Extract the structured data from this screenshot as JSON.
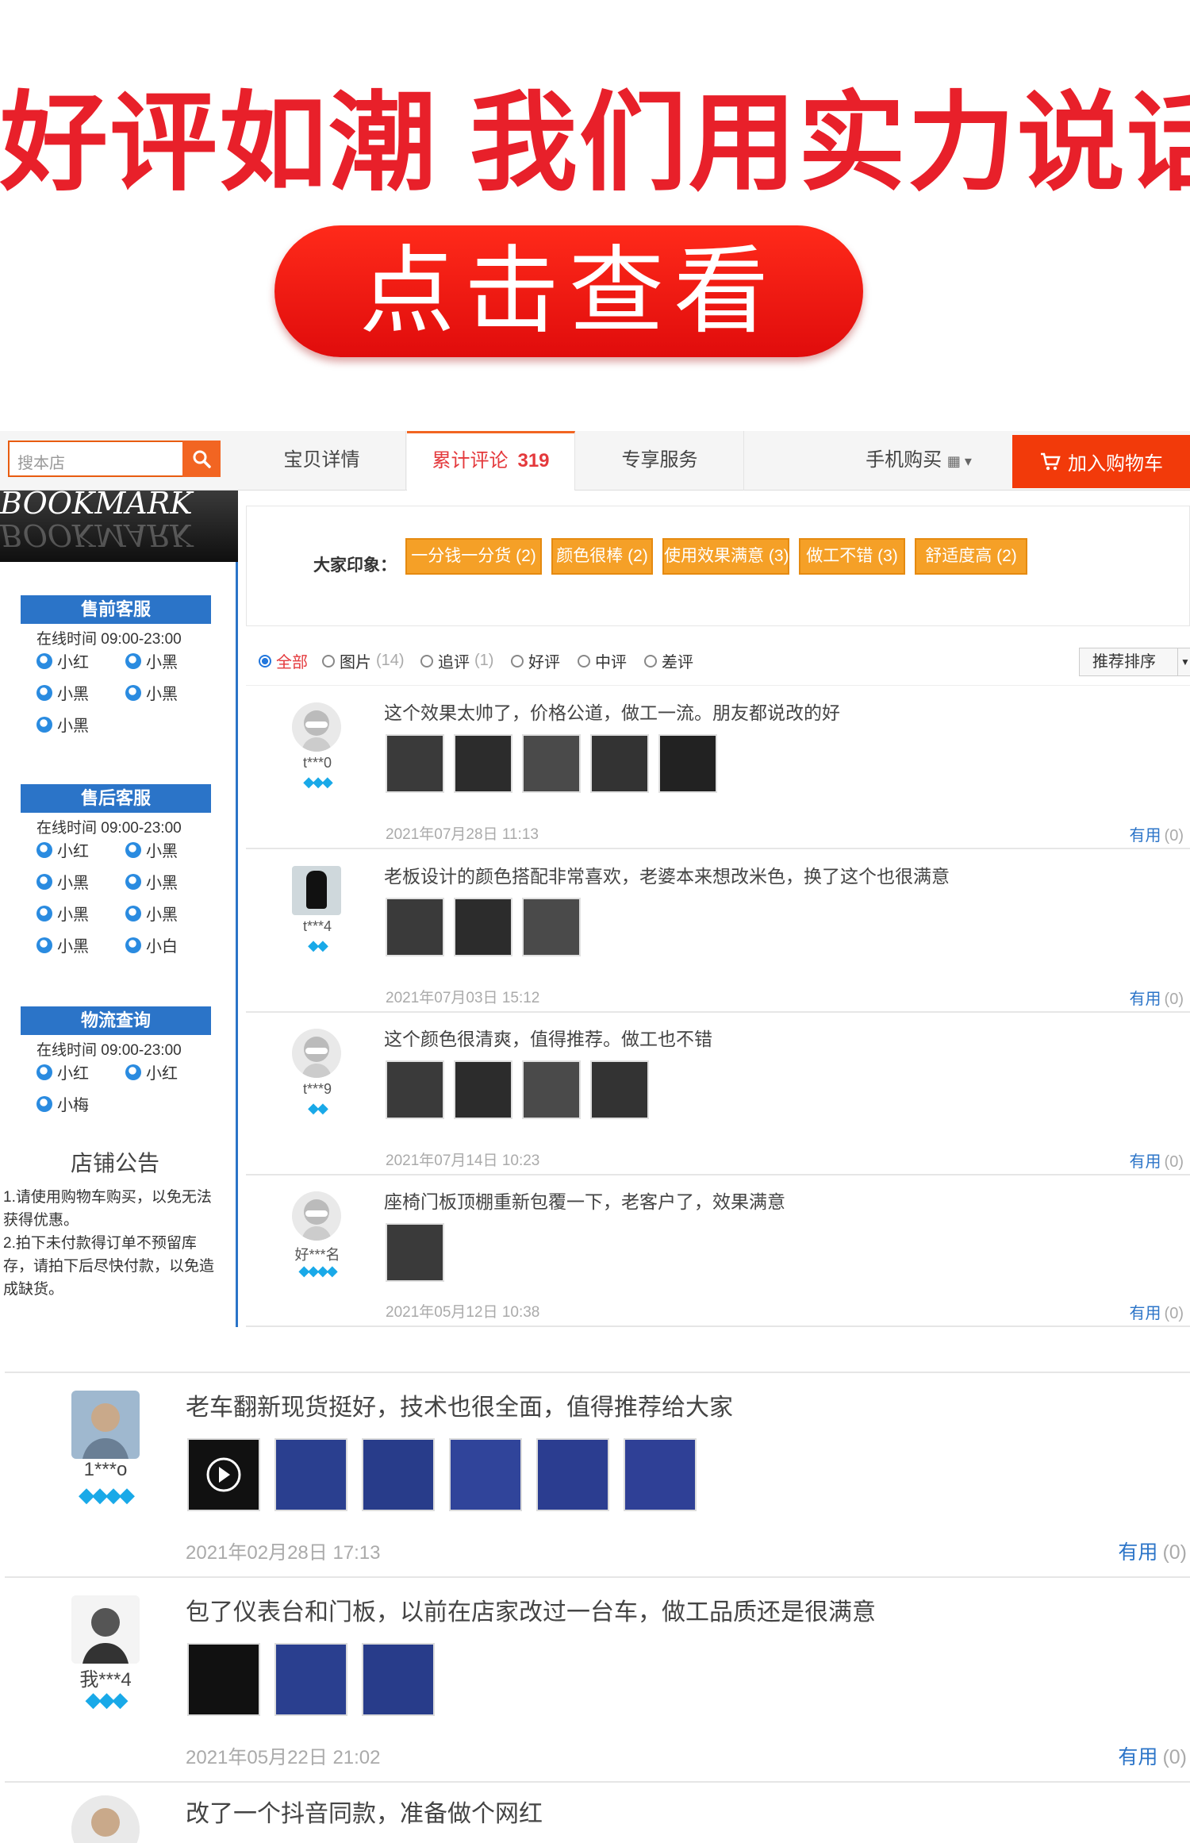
{
  "banner": {
    "slogan": "好评如潮  我们用实力说话",
    "cta_label": "点击查看"
  },
  "shop": {
    "search_placeholder": "搜本店",
    "tabs": [
      {
        "label": "宝贝详情"
      },
      {
        "label": "累计评论",
        "count": "319"
      },
      {
        "label": "专享服务"
      },
      {
        "label": "手机购买"
      }
    ],
    "cart_label": "加入购物车",
    "logo_text": "BOOKMARK",
    "service_groups": [
      {
        "title": "售前客服",
        "hours": "在线时间 09:00-23:00",
        "agents": [
          "小红",
          "小黑",
          "小黑",
          "小黑",
          "小黑"
        ]
      },
      {
        "title": "售后客服",
        "hours": "在线时间 09:00-23:00",
        "agents": [
          "小红",
          "小黑",
          "小黑",
          "小黑",
          "小黑",
          "小黑",
          "小黑",
          "小白"
        ]
      },
      {
        "title": "物流查询",
        "hours": "在线时间 09:00-23:00",
        "agents": [
          "小红",
          "小红",
          "小梅"
        ]
      }
    ],
    "notice_title": "店铺公告",
    "notice_text": [
      "1.请使用购物车购买，以免无法获得优惠。",
      "2.拍下未付款得订单不预留库存，请拍下后尽快付款，以免造成缺货。"
    ],
    "impression_label": "大家印象：",
    "impression_tags": [
      "一分钱一分货 (2)",
      "颜色很棒 (2)",
      "使用效果满意 (3)",
      "做工不错 (3)",
      "舒适度高 (2)"
    ],
    "filters": [
      {
        "label": "全部",
        "count": "",
        "selected": true
      },
      {
        "label": "图片",
        "count": "(14)"
      },
      {
        "label": "追评",
        "count": "(1)"
      },
      {
        "label": "好评",
        "count": ""
      },
      {
        "label": "中评",
        "count": ""
      },
      {
        "label": "差评",
        "count": ""
      }
    ],
    "sort_label": "推荐排序",
    "reviews": [
      {
        "user": "t***0",
        "gems": "◆◆◆",
        "text": "这个效果太帅了，价格公道，做工一流。朋友都说改的好",
        "photos": 5,
        "date": "2021年07月28日 11:13",
        "useful": "有用",
        "useful_count": "(0)"
      },
      {
        "user": "t***4",
        "gems": "◆◆",
        "text": "老板设计的颜色搭配非常喜欢，老婆本来想改米色，换了这个也很满意",
        "photos": 3,
        "date": "2021年07月03日 15:12",
        "useful": "有用",
        "useful_count": "(0)"
      },
      {
        "user": "t***9",
        "gems": "◆◆",
        "text": "这个颜色很清爽，值得推荐。做工也不错",
        "photos": 4,
        "date": "2021年07月14日 10:23",
        "useful": "有用",
        "useful_count": "(0)"
      },
      {
        "user": "好***名",
        "gems": "◆◆◆◆",
        "text": "座椅门板顶棚重新包覆一下，老客户了，效果满意",
        "photos": 1,
        "date": "2021年05月12日 10:38",
        "useful": "有用",
        "useful_count": "(0)"
      }
    ]
  },
  "reviews_large": [
    {
      "user": "1***o",
      "gems": "◆◆◆◆",
      "text": "老车翻新现货挺好，技术也很全面，值得推荐给大家",
      "photos": 6,
      "date": "2021年02月28日 17:13",
      "useful": "有用",
      "useful_count": "(0)"
    },
    {
      "user": "我***4",
      "gems": "◆◆◆",
      "text": "包了仪表台和门板，以前在店家改过一台车，做工品质还是很满意",
      "photos": 3,
      "date": "2021年05月22日 21:02",
      "useful": "有用",
      "useful_count": "(0)"
    },
    {
      "user": "",
      "gems": "",
      "text": "改了一个抖音同款，准备做个网红",
      "photos": 0,
      "date": "",
      "useful": "",
      "useful_count": ""
    }
  ],
  "colors": {
    "brand_red": "#e8202a",
    "accent_orange": "#f26522",
    "tag_orange": "#f5a027",
    "link_blue": "#2b74c8",
    "gem_blue": "#19a9e8"
  }
}
